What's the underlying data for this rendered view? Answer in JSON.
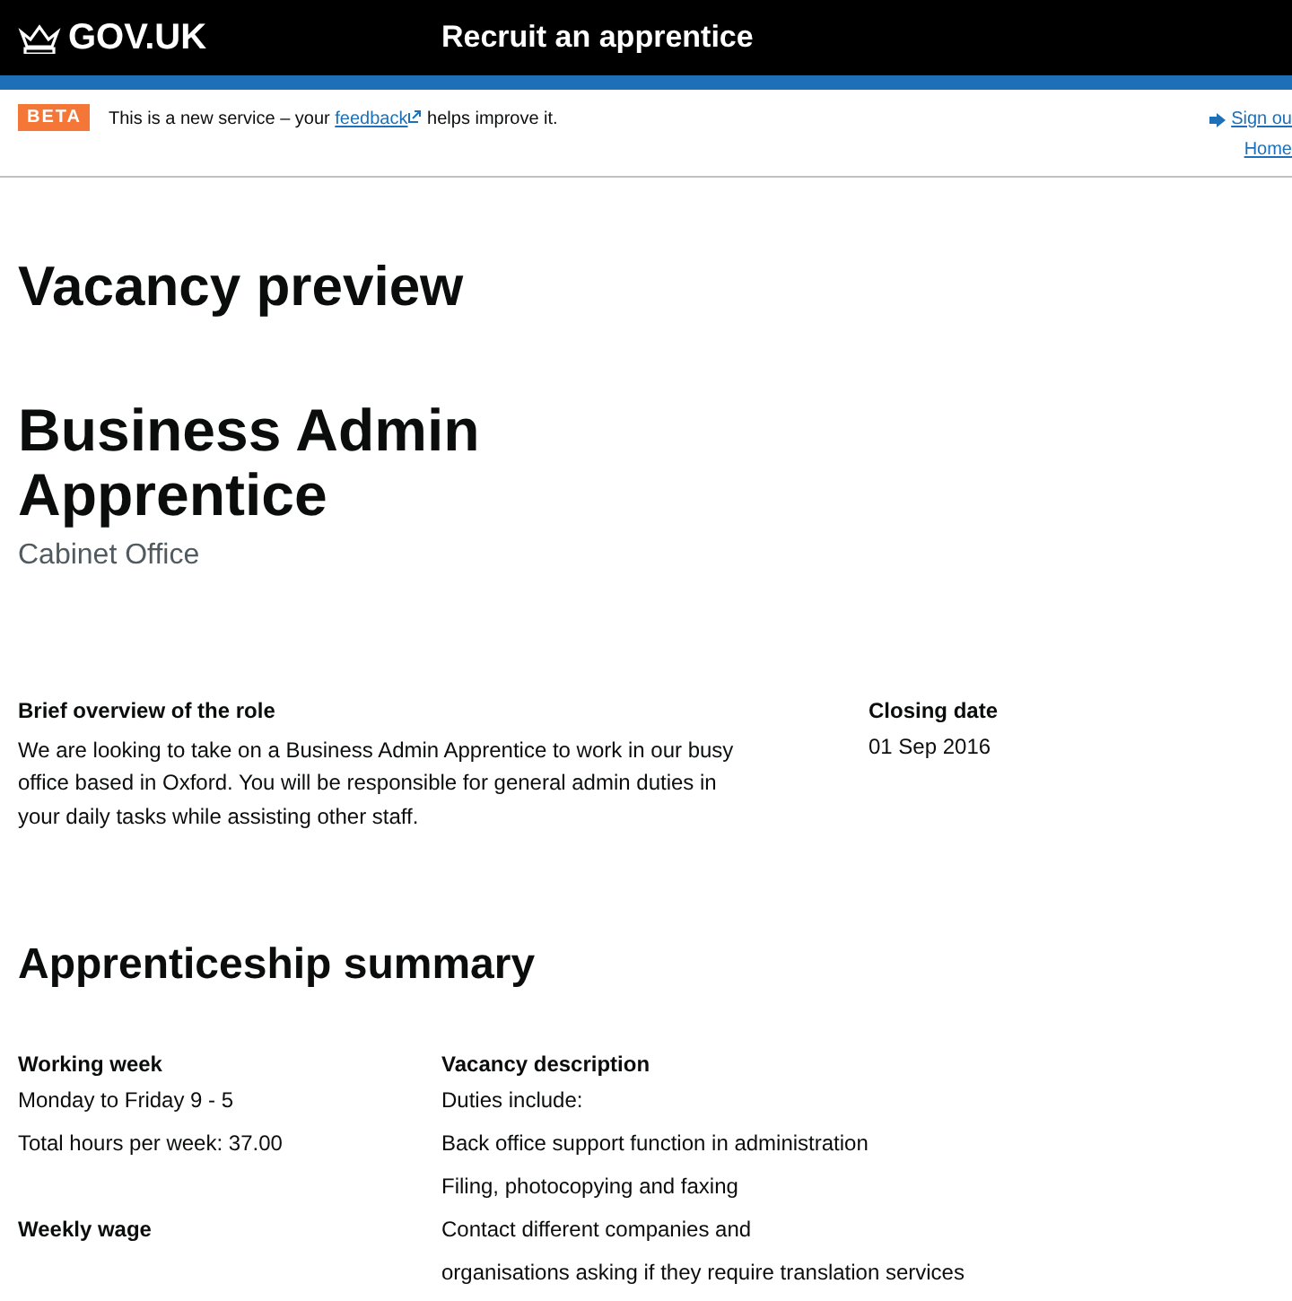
{
  "header": {
    "logo": "GOV.UK",
    "service": "Recruit an apprentice"
  },
  "phase_banner": {
    "tag": "BETA",
    "text_before": "This is a new service – your",
    "link": "feedback",
    "text_after": "helps improve it."
  },
  "account_links": [
    {
      "label": "Sign ou",
      "kind": "signout"
    },
    {
      "label": "Home",
      "kind": "plain"
    }
  ],
  "page_title": "Vacancy preview",
  "vacancy": {
    "title": "Business Admin Apprentice",
    "employer": "Cabinet Office"
  },
  "overview": {
    "heading": "Brief overview of the role",
    "text": "We are looking to take on a Business Admin Apprentice to work in our busy office based in Oxford. You will be responsible for general admin duties in your daily tasks while assisting other staff."
  },
  "closing": {
    "heading": "Closing date",
    "value": "01 Sep 2016"
  },
  "summary": {
    "heading": "Apprenticeship summary",
    "left": [
      {
        "heading": "Working week",
        "lines": [
          "Monday to Friday 9 - 5",
          "Total hours per week: 37.00"
        ]
      },
      {
        "heading": "Weekly wage"
      }
    ],
    "right": {
      "heading": "Vacancy description",
      "lines": [
        "Duties include:",
        "Back office support function in administration",
        "Filing, photocopying and faxing",
        "Contact different companies and",
        "organisations asking if they require translation services"
      ]
    }
  }
}
